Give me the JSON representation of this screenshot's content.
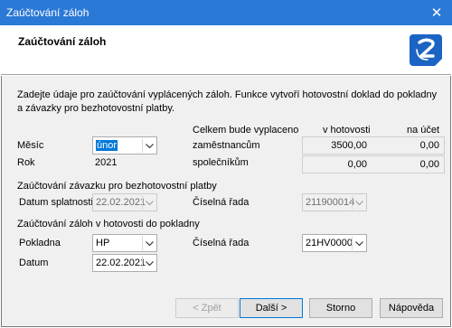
{
  "window": {
    "title": "Zaúčtování záloh",
    "close_glyph": "✕"
  },
  "header": {
    "heading": "Zaúčtování záloh",
    "logo_icon": "app-logo-z-icon",
    "logo_color": "#1c64c4"
  },
  "description": "Zadejte údaje pro zaúčtování vyplácených záloh. Funkce vytvoří hotovostní doklad do pokladny a závazky pro bezhotovostní platby.",
  "period": {
    "month_label": "Měsíc",
    "month_value": "únor",
    "year_label": "Rok",
    "year_value": "2021"
  },
  "summary": {
    "caption": "Celkem bude vyplaceno",
    "col_cash": "v hotovosti",
    "col_account": "na účet",
    "rows": [
      {
        "label": "zaměstnancům",
        "cash": "3500,00",
        "account": "0,00"
      },
      {
        "label": "společníkům",
        "cash": "0,00",
        "account": "0,00"
      }
    ]
  },
  "cashless": {
    "section_label": "Zaúčtování závazku pro bezhotovostní platby",
    "due_date_label": "Datum splatnosti",
    "due_date_value": "22.02.2021",
    "series_label": "Číselná řada",
    "series_value": "211900014"
  },
  "cash": {
    "section_label": "Zaúčtování záloh v hotovosti do pokladny",
    "register_label": "Pokladna",
    "register_value": "HP",
    "series_label": "Číselná řada",
    "series_value": "21HV0000",
    "date_label": "Datum",
    "date_value": "22.02.2021"
  },
  "buttons": {
    "back": "< Zpět",
    "next": "Další >",
    "cancel": "Storno",
    "help": "Nápověda"
  }
}
